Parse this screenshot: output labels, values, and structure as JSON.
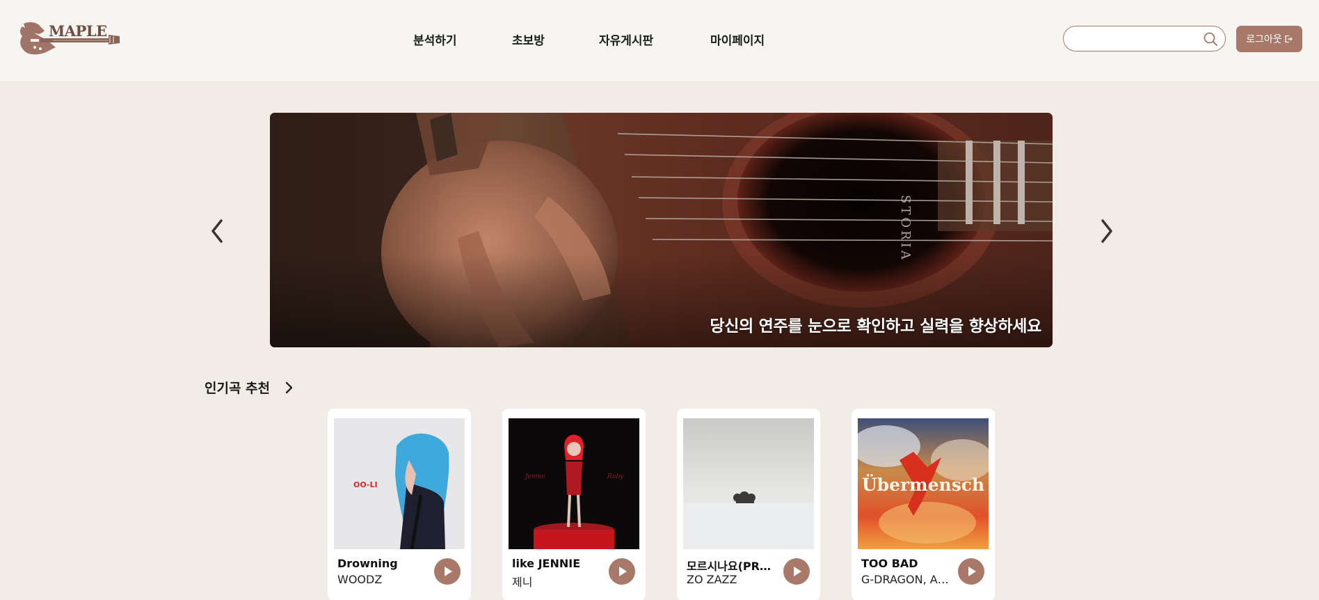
{
  "header": {
    "logo_text": "MAPLE",
    "nav": [
      {
        "label": "분석하기"
      },
      {
        "label": "초보방"
      },
      {
        "label": "자유게시판"
      },
      {
        "label": "마이페이지"
      }
    ],
    "search": {
      "value": "",
      "placeholder": ""
    },
    "logout_label": "로그아웃"
  },
  "banner": {
    "caption": "당신의 연주를 눈으로 확인하고 실력을 향상하세요",
    "guitar_brand": "STORIA"
  },
  "popular": {
    "title": "인기곡 추천",
    "songs": [
      {
        "title": "Drowning",
        "artist": "WOODZ",
        "cover_text": "OO-LI"
      },
      {
        "title": "like JENNIE",
        "artist": "제니",
        "cover_text_left": "Jennie",
        "cover_text_right": "Ruby"
      },
      {
        "title": "모르시나요(PROD.ROCOBERRY)",
        "artist": "ZO ZAZZ"
      },
      {
        "title": "TOO BAD",
        "artist": "G-DRAGON, Anderson .Paak",
        "cover_text": "Übermensch"
      }
    ]
  },
  "colors": {
    "accent": "#a87868",
    "page_bg": "#f1ede6",
    "header_bg": "#f7f5f1"
  }
}
